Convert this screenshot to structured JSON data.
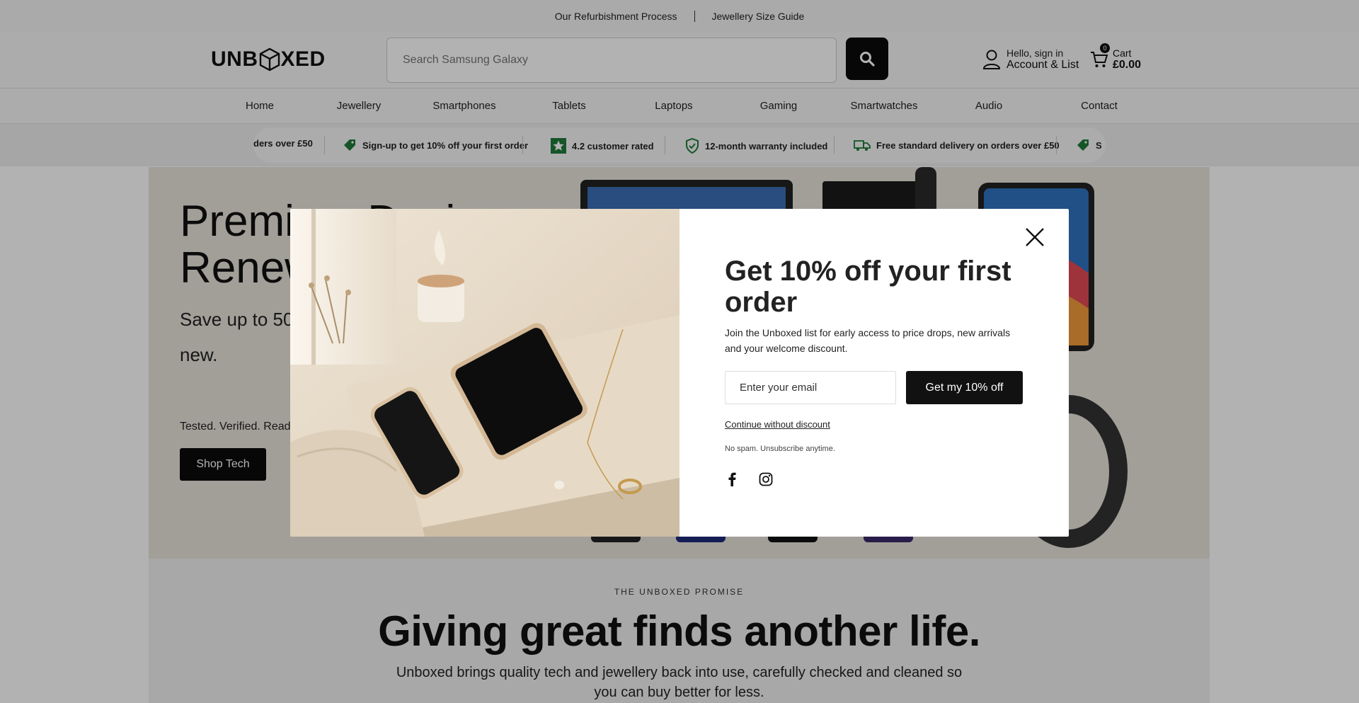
{
  "topbar": {
    "link1": "Our Refurbishment Process",
    "link2": "Jewellery Size Guide"
  },
  "header": {
    "logo": "UNBOXED",
    "search_placeholder": "Search Samsung Galaxy",
    "account_line1": "Hello, sign in",
    "account_line2": "Account & List",
    "cart_count": "0",
    "cart_label": "Cart",
    "cart_total": "£0.00"
  },
  "nav": {
    "items": [
      "Home",
      "Jewellery",
      "Smartphones",
      "Tablets",
      "Laptops",
      "Gaming",
      "Smartwatches",
      "Audio",
      "Contact"
    ]
  },
  "strip": {
    "items": [
      "ders over £50",
      "Sign-up to get 10% off your first order",
      "4.2 customer rated",
      "12-month warranty included",
      "Free standard delivery on orders over £50",
      "S"
    ]
  },
  "hero": {
    "title": "Premium Devices Renewed",
    "subtitle": "Save up to 50% on refurbished tech that works like new.",
    "small": "Tested. Verified. Ready.",
    "button": "Shop Tech"
  },
  "promise": {
    "eyebrow": "THE UNBOXED PROMISE",
    "title": "Giving great finds another life.",
    "text": "Unboxed brings quality tech and jewellery back into use, carefully checked and cleaned so you can buy better for less."
  },
  "modal": {
    "title": "Get 10% off your first order",
    "text": "Join the Unboxed list for early access to price drops, new arrivals and your welcome discount.",
    "email_placeholder": "Enter your email",
    "cta": "Get my 10% off",
    "continue": "Continue without discount",
    "nospam": "No spam. Unsubscribe anytime.",
    "social_icons": [
      "facebook-icon",
      "instagram-icon"
    ]
  },
  "colors": {
    "primary": "#111111",
    "accent_green": "#1f7a3a",
    "overlay": "rgba(0,0,0,0.30)"
  }
}
